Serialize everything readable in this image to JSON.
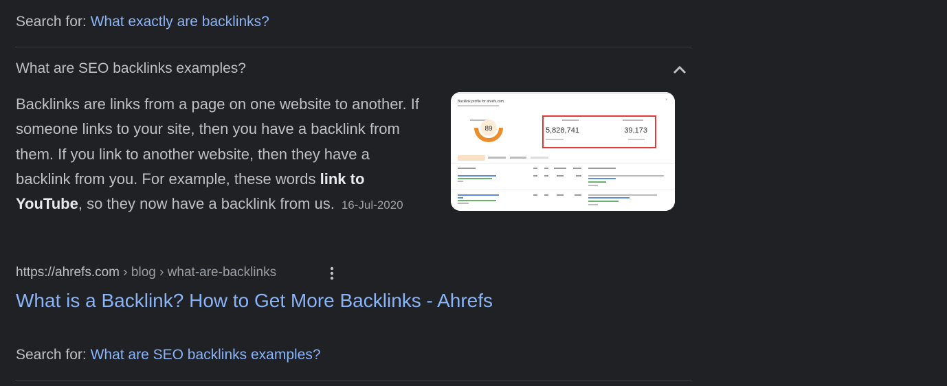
{
  "search_for_top": {
    "prefix": "Search for:",
    "link": "What exactly are backlinks?"
  },
  "accordion": {
    "question": "What are SEO backlinks examples?",
    "answer_before": "Backlinks are links from a page on one website to another. If someone links to your site, then you have a backlink from them. If you link to another website, then they have a backlink from you. For example, these words ",
    "answer_bold": "link to YouTube",
    "answer_after": ", so they now have a backlink from us.",
    "date": "16-Jul-2020",
    "icons": {
      "collapse": "chevron-up-icon"
    }
  },
  "thumbnail": {
    "header": "Backlink profile for ahrefs.com",
    "domain_rating": "89",
    "backlinks": "5,828,741",
    "referring_domains": "39,173"
  },
  "result": {
    "domain": "https://ahrefs.com",
    "path": " › blog › what-are-backlinks",
    "title": "What is a Backlink? How to Get More Backlinks - Ahrefs",
    "icons": {
      "menu": "more-vert-icon"
    }
  },
  "search_for_bottom": {
    "prefix": "Search for:",
    "link": "What are SEO backlinks examples?"
  },
  "colors": {
    "background": "#202124",
    "text": "#bdc1c6",
    "link": "#8ab4f8",
    "divider": "#3c4043"
  }
}
